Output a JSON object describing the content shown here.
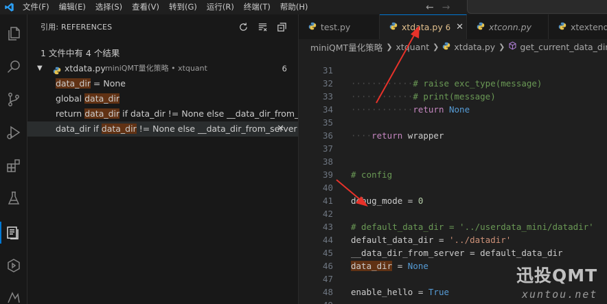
{
  "titlebar": {
    "menus": [
      "文件(F)",
      "编辑(E)",
      "选择(S)",
      "查看(V)",
      "转到(G)",
      "运行(R)",
      "终端(T)",
      "帮助(H)"
    ],
    "back_arrow": "←",
    "forward_arrow": "→"
  },
  "activity_bar": {
    "icons": [
      "explorer-icon",
      "search-icon",
      "source-control-icon",
      "run-debug-icon",
      "extensions-icon",
      "testing-icon",
      "references-icon",
      "remote-icon",
      "python-icon"
    ]
  },
  "references": {
    "title": "引用: REFERENCES",
    "summary": "1 文件中有 4 个结果",
    "file": {
      "name": "xtdata.py",
      "description": "miniQMT量化策略 • xtquant",
      "count": "6"
    },
    "results": [
      {
        "before": "",
        "match": "data_dir",
        "after": " = None"
      },
      {
        "before": "global ",
        "match": "data_dir",
        "after": ""
      },
      {
        "before": "return ",
        "match": "data_dir",
        "after": " if data_dir != None else __data_dir_from_s..."
      },
      {
        "before": "data_dir if ",
        "match": "data_dir",
        "after": " != None else __data_dir_from_server"
      }
    ],
    "close_glyph": "✕"
  },
  "editor": {
    "tabs": [
      {
        "label": "test.py",
        "active": false,
        "italic": false
      },
      {
        "label": "xtdata.py",
        "active": true,
        "italic": false,
        "badge": "6",
        "close": "✕"
      },
      {
        "label": "xtconn.py",
        "active": false,
        "italic": true
      },
      {
        "label": "xtextend.",
        "active": false,
        "italic": false
      }
    ],
    "breadcrumb": [
      "miniQMT量化策略",
      "xtquant",
      "xtdata.py",
      "get_current_data_dir"
    ],
    "lines": {
      "l31": {
        "num": "31",
        "comment": "# raise exc_type(message)"
      },
      "l32": {
        "num": "32",
        "comment": "# print(message)"
      },
      "l33": {
        "num": "33",
        "kw": "return",
        "const": "None"
      },
      "l34": {
        "num": "34"
      },
      "l35": {
        "num": "35",
        "kw": "return",
        "name": "wrapper"
      },
      "l36": {
        "num": "36"
      },
      "l37": {
        "num": "37"
      },
      "l38": {
        "num": "38",
        "comment": "# config"
      },
      "l39": {
        "num": "39"
      },
      "l40": {
        "num": "40",
        "name": "debug_mode",
        "op": " = ",
        "value": "0"
      },
      "l41": {
        "num": "41"
      },
      "l42": {
        "num": "42",
        "comment": "# default_data_dir = '../userdata_mini/datadir'"
      },
      "l43": {
        "num": "43",
        "name": "default_data_dir",
        "op": " = ",
        "value": "'../datadir'"
      },
      "l44": {
        "num": "44",
        "name": "__data_dir_from_server",
        "op": " = ",
        "value": "default_data_dir"
      },
      "l45": {
        "num": "45",
        "name": "data_dir",
        "op": " = ",
        "value": "None"
      },
      "l46": {
        "num": "46"
      },
      "l47": {
        "num": "47",
        "name": "enable_hello",
        "op": " = ",
        "value": "True"
      },
      "l48": {
        "num": "48"
      },
      "l49": {
        "num": "49"
      }
    }
  },
  "watermark": {
    "big": "迅投QMT",
    "small": "xuntou.net"
  },
  "colors": {
    "accent": "#0078d4",
    "arrow": "#e8322a",
    "highlight": "#613214",
    "modified": "#e2c08d"
  }
}
